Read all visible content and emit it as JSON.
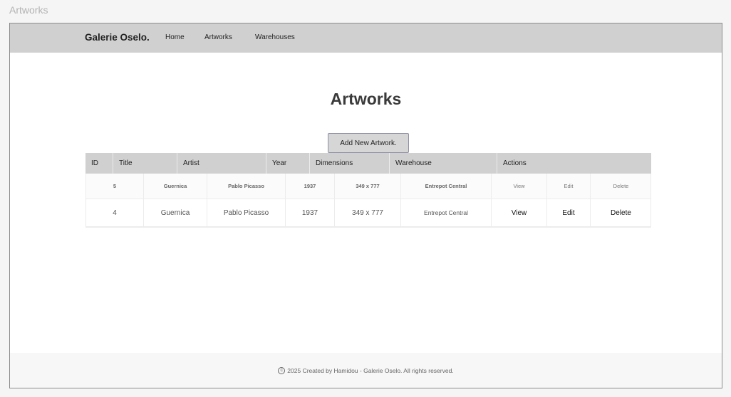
{
  "window": {
    "title": "Artworks"
  },
  "navbar": {
    "brand": "Galerie Oselo.",
    "links": [
      "Home",
      "Artworks",
      "Warehouses"
    ]
  },
  "main": {
    "title": "Artworks",
    "add_button": "Add New Artwork.",
    "columns": [
      "ID",
      "Title",
      "Artist",
      "Year",
      "Dimensions",
      "Warehouse",
      "Actions"
    ],
    "rows": [
      {
        "id": "5",
        "title": "Guernica",
        "artist": "Pablo Picasso",
        "year": "1937",
        "dimensions": "349 x 777",
        "warehouse": "Entrepot Central",
        "actions": [
          "View",
          "Edit",
          "Delete"
        ]
      },
      {
        "id": "4",
        "title": "Guernica",
        "artist": "Pablo Picasso",
        "year": "1937",
        "dimensions": "349 x 777",
        "warehouse": "Entrepot Central",
        "actions": [
          "View",
          "Edit",
          "Delete"
        ]
      }
    ]
  },
  "footer": {
    "icon": "copyright-icon",
    "text": "2025 Created by Hamidou - Galerie Oselo. All rights reserved."
  }
}
